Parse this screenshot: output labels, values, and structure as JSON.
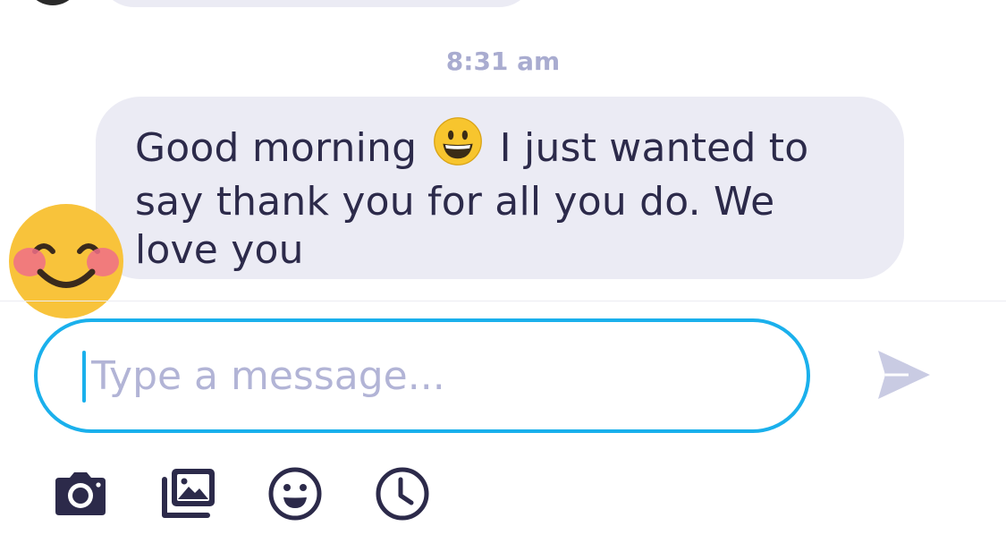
{
  "conversation": {
    "timestamp": "8:31 am",
    "message": {
      "text_before_emoji": "Good morning",
      "inline_emoji": "grinning-face",
      "text_after_emoji": "I just wanted to say thank you for all you do. We love you",
      "sender_avatar": "smiling-face-with-smiling-eyes"
    }
  },
  "composer": {
    "placeholder": "Type a message...",
    "value": "",
    "send_icon": "send-icon"
  },
  "toolbar": {
    "icons": [
      "camera-icon",
      "gallery-icon",
      "emoji-icon",
      "clock-icon"
    ]
  },
  "colors": {
    "accent": "#1ab0ec",
    "bubble_bg": "#ebebf4",
    "text": "#2c2a4a",
    "muted": "#a9acd0",
    "icon": "#2c2a4a",
    "send_disabled": "#c9cbe3"
  }
}
